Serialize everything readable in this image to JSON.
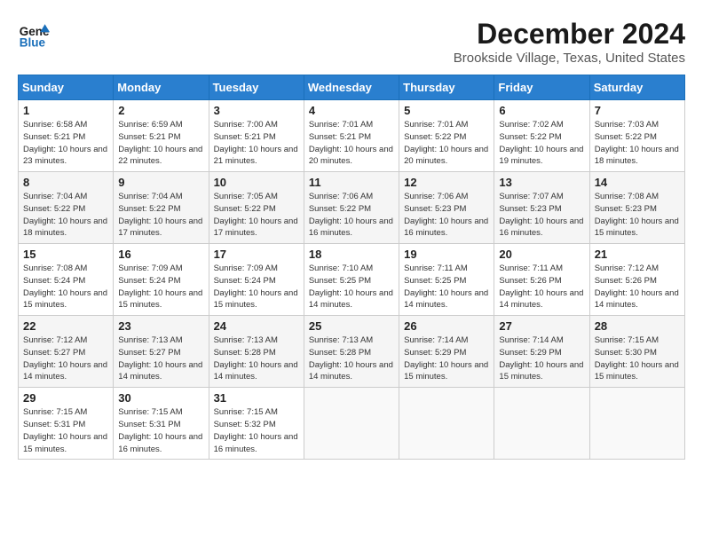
{
  "header": {
    "logo_line1": "General",
    "logo_line2": "Blue",
    "month": "December 2024",
    "location": "Brookside Village, Texas, United States"
  },
  "weekdays": [
    "Sunday",
    "Monday",
    "Tuesday",
    "Wednesday",
    "Thursday",
    "Friday",
    "Saturday"
  ],
  "weeks": [
    [
      {
        "day": "1",
        "sunrise": "6:58 AM",
        "sunset": "5:21 PM",
        "daylight": "10 hours and 23 minutes."
      },
      {
        "day": "2",
        "sunrise": "6:59 AM",
        "sunset": "5:21 PM",
        "daylight": "10 hours and 22 minutes."
      },
      {
        "day": "3",
        "sunrise": "7:00 AM",
        "sunset": "5:21 PM",
        "daylight": "10 hours and 21 minutes."
      },
      {
        "day": "4",
        "sunrise": "7:01 AM",
        "sunset": "5:21 PM",
        "daylight": "10 hours and 20 minutes."
      },
      {
        "day": "5",
        "sunrise": "7:01 AM",
        "sunset": "5:22 PM",
        "daylight": "10 hours and 20 minutes."
      },
      {
        "day": "6",
        "sunrise": "7:02 AM",
        "sunset": "5:22 PM",
        "daylight": "10 hours and 19 minutes."
      },
      {
        "day": "7",
        "sunrise": "7:03 AM",
        "sunset": "5:22 PM",
        "daylight": "10 hours and 18 minutes."
      }
    ],
    [
      {
        "day": "8",
        "sunrise": "7:04 AM",
        "sunset": "5:22 PM",
        "daylight": "10 hours and 18 minutes."
      },
      {
        "day": "9",
        "sunrise": "7:04 AM",
        "sunset": "5:22 PM",
        "daylight": "10 hours and 17 minutes."
      },
      {
        "day": "10",
        "sunrise": "7:05 AM",
        "sunset": "5:22 PM",
        "daylight": "10 hours and 17 minutes."
      },
      {
        "day": "11",
        "sunrise": "7:06 AM",
        "sunset": "5:22 PM",
        "daylight": "10 hours and 16 minutes."
      },
      {
        "day": "12",
        "sunrise": "7:06 AM",
        "sunset": "5:23 PM",
        "daylight": "10 hours and 16 minutes."
      },
      {
        "day": "13",
        "sunrise": "7:07 AM",
        "sunset": "5:23 PM",
        "daylight": "10 hours and 16 minutes."
      },
      {
        "day": "14",
        "sunrise": "7:08 AM",
        "sunset": "5:23 PM",
        "daylight": "10 hours and 15 minutes."
      }
    ],
    [
      {
        "day": "15",
        "sunrise": "7:08 AM",
        "sunset": "5:24 PM",
        "daylight": "10 hours and 15 minutes."
      },
      {
        "day": "16",
        "sunrise": "7:09 AM",
        "sunset": "5:24 PM",
        "daylight": "10 hours and 15 minutes."
      },
      {
        "day": "17",
        "sunrise": "7:09 AM",
        "sunset": "5:24 PM",
        "daylight": "10 hours and 15 minutes."
      },
      {
        "day": "18",
        "sunrise": "7:10 AM",
        "sunset": "5:25 PM",
        "daylight": "10 hours and 14 minutes."
      },
      {
        "day": "19",
        "sunrise": "7:11 AM",
        "sunset": "5:25 PM",
        "daylight": "10 hours and 14 minutes."
      },
      {
        "day": "20",
        "sunrise": "7:11 AM",
        "sunset": "5:26 PM",
        "daylight": "10 hours and 14 minutes."
      },
      {
        "day": "21",
        "sunrise": "7:12 AM",
        "sunset": "5:26 PM",
        "daylight": "10 hours and 14 minutes."
      }
    ],
    [
      {
        "day": "22",
        "sunrise": "7:12 AM",
        "sunset": "5:27 PM",
        "daylight": "10 hours and 14 minutes."
      },
      {
        "day": "23",
        "sunrise": "7:13 AM",
        "sunset": "5:27 PM",
        "daylight": "10 hours and 14 minutes."
      },
      {
        "day": "24",
        "sunrise": "7:13 AM",
        "sunset": "5:28 PM",
        "daylight": "10 hours and 14 minutes."
      },
      {
        "day": "25",
        "sunrise": "7:13 AM",
        "sunset": "5:28 PM",
        "daylight": "10 hours and 14 minutes."
      },
      {
        "day": "26",
        "sunrise": "7:14 AM",
        "sunset": "5:29 PM",
        "daylight": "10 hours and 15 minutes."
      },
      {
        "day": "27",
        "sunrise": "7:14 AM",
        "sunset": "5:29 PM",
        "daylight": "10 hours and 15 minutes."
      },
      {
        "day": "28",
        "sunrise": "7:15 AM",
        "sunset": "5:30 PM",
        "daylight": "10 hours and 15 minutes."
      }
    ],
    [
      {
        "day": "29",
        "sunrise": "7:15 AM",
        "sunset": "5:31 PM",
        "daylight": "10 hours and 15 minutes."
      },
      {
        "day": "30",
        "sunrise": "7:15 AM",
        "sunset": "5:31 PM",
        "daylight": "10 hours and 16 minutes."
      },
      {
        "day": "31",
        "sunrise": "7:15 AM",
        "sunset": "5:32 PM",
        "daylight": "10 hours and 16 minutes."
      },
      null,
      null,
      null,
      null
    ]
  ],
  "labels": {
    "sunrise": "Sunrise: ",
    "sunset": "Sunset: ",
    "daylight": "Daylight: "
  }
}
